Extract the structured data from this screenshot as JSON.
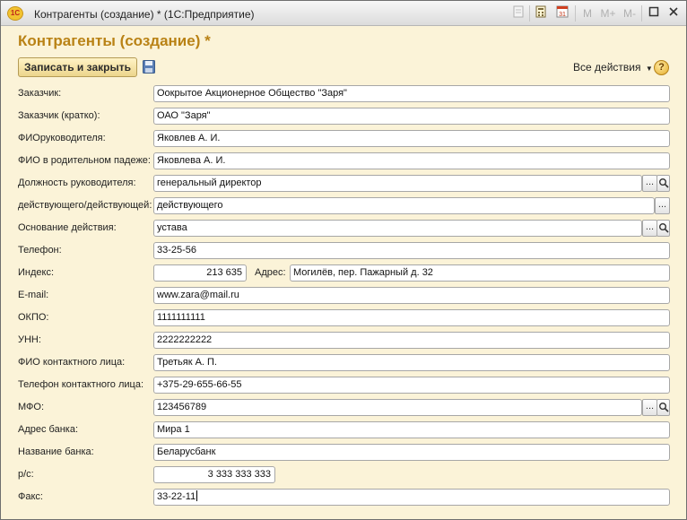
{
  "window": {
    "title": "Контрагенты (создание) * (1С:Предприятие)",
    "logo": "1С",
    "toolbar": {
      "m": "M",
      "m_plus": "M+",
      "m_minus": "M-",
      "calendar_day": "31",
      "icons": [
        "document-icon",
        "calculator-icon",
        "calendar-icon",
        "minimize-icon",
        "maximize-icon",
        "close-icon"
      ]
    }
  },
  "form": {
    "title": "Контрагенты (создание) *",
    "actions": {
      "save_close": "Записать и закрыть",
      "all_actions": "Все действия",
      "help": "?"
    },
    "fields": {
      "customer": {
        "label": "Заказчик:",
        "value": "Оокрытое Акционерное Общество \"Заря\""
      },
      "customer_short": {
        "label": "Заказчик (кратко):",
        "value": "ОАО \"Заря\""
      },
      "director": {
        "label": "ФИОруководителя:",
        "value": "Яковлев А. И."
      },
      "director_genitive": {
        "label": "ФИО в родительном падеже:",
        "value": "Яковлева А. И."
      },
      "position": {
        "label": "Должность руководителя:",
        "value": "генеральный директор"
      },
      "acting": {
        "label": "действующего/действующей:",
        "value": "действующего"
      },
      "basis": {
        "label": "Основание действия:",
        "value": "устава"
      },
      "phone": {
        "label": "Телефон:",
        "value": "33-25-56"
      },
      "postcode": {
        "label": "Индекс:",
        "value": "213 635"
      },
      "address": {
        "label": "Адрес:",
        "value": "Могилёв, пер. Пажарный д. 32"
      },
      "email": {
        "label": "E-mail:",
        "value": "www.zara@mail.ru"
      },
      "okpo": {
        "label": "ОКПО:",
        "value": "1111111111"
      },
      "unn": {
        "label": "УНН:",
        "value": "2222222222"
      },
      "contact": {
        "label": "ФИО контактного лица:",
        "value": "Третьяк А. П."
      },
      "contact_phone": {
        "label": "Телефон контактного лица:",
        "value": "+375-29-655-66-55"
      },
      "mfo": {
        "label": "МФО:",
        "value": "123456789"
      },
      "bank_address": {
        "label": "Адрес банка:",
        "value": "Мира 1"
      },
      "bank_name": {
        "label": "Название банка:",
        "value": "Беларусбанк"
      },
      "account": {
        "label": "р/с:",
        "value": "3 333 333 333"
      },
      "fax": {
        "label": "Факс:",
        "value": "33-22-11"
      }
    },
    "select_button": "...",
    "search_icon": "magnifier-icon"
  },
  "colors": {
    "form_background": "#fbf3d8",
    "title_color": "#b98215",
    "button_gradient_top": "#fff3c6",
    "button_gradient_bottom": "#ecd58c"
  }
}
